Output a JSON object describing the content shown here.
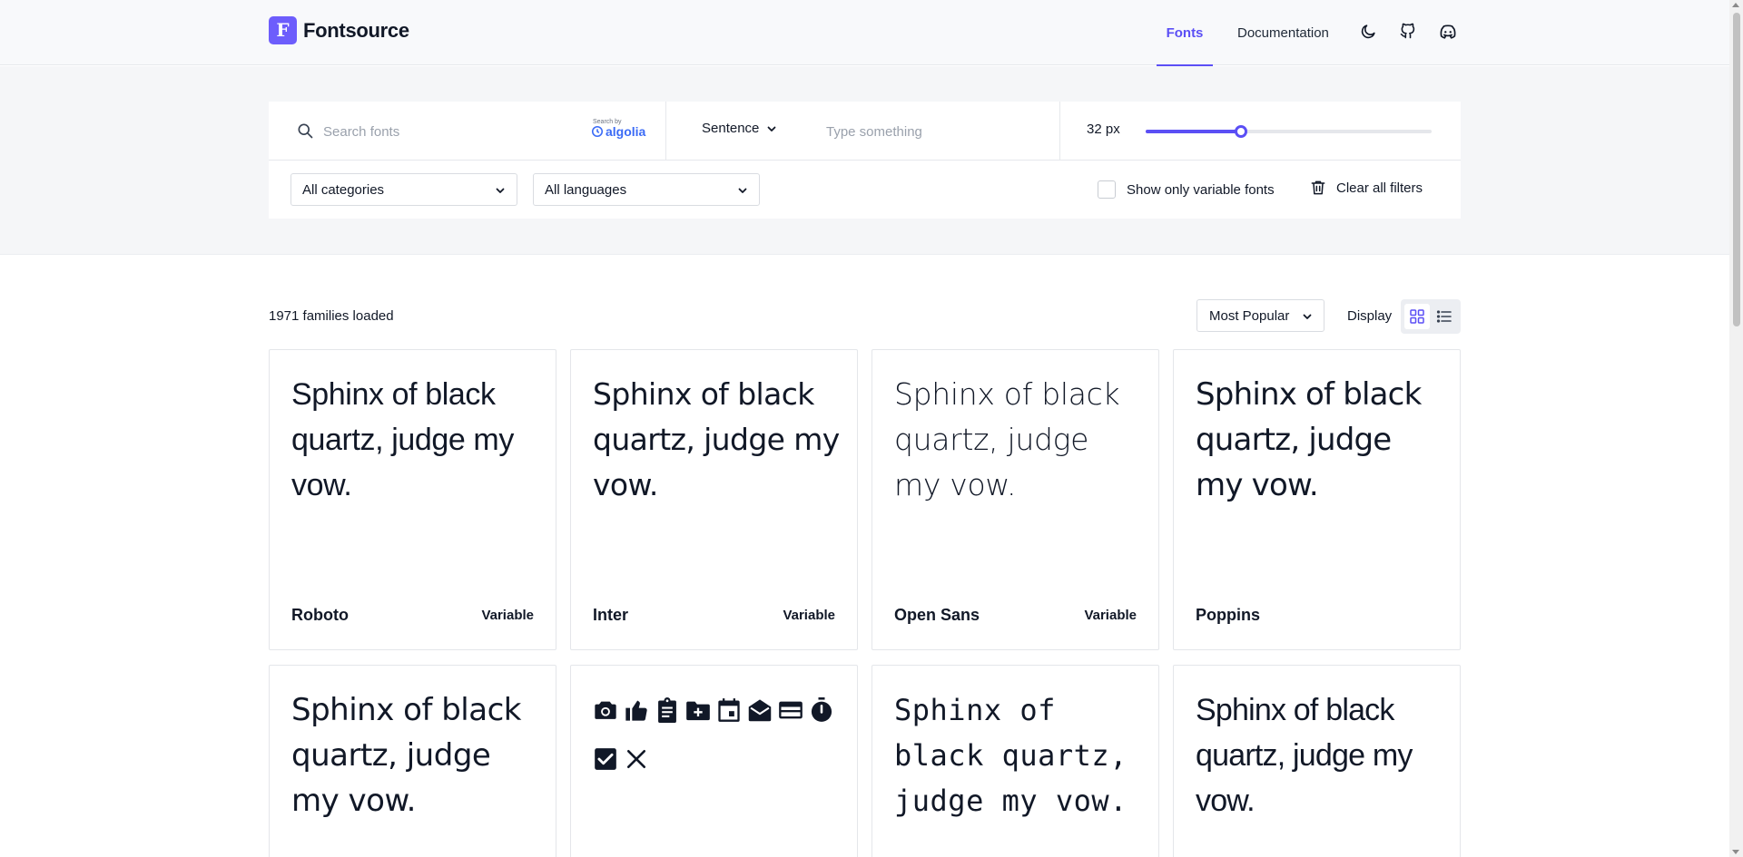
{
  "header": {
    "logo_letter": "F",
    "logo_text": "Fontsource",
    "nav": [
      {
        "label": "Fonts",
        "active": true
      },
      {
        "label": "Documentation",
        "active": false
      }
    ],
    "icons": [
      "moon-icon",
      "github-icon",
      "discord-icon"
    ]
  },
  "search": {
    "placeholder": "Search fonts",
    "value": "",
    "powered_small": "Search by",
    "powered_brand": "algolia"
  },
  "preview": {
    "mode": "Sentence",
    "placeholder": "Type something",
    "value": ""
  },
  "size": {
    "label": "32 px",
    "value": 32,
    "min": 8,
    "max": 80
  },
  "filters": {
    "category": "All categories",
    "language": "All languages",
    "variable_label": "Show only variable fonts",
    "variable_checked": false,
    "clear_label": "Clear all filters"
  },
  "results": {
    "count_text": "1971 families loaded",
    "sort": "Most Popular",
    "display_label": "Display",
    "display_mode": "grid"
  },
  "cards": [
    {
      "name": "Roboto",
      "badge": "Variable",
      "preview": "Sphinx of black quartz, judge my vow."
    },
    {
      "name": "Inter",
      "badge": "Variable",
      "preview": "Sphinx of black quartz, judge my vow."
    },
    {
      "name": "Open Sans",
      "badge": "Variable",
      "preview": "Sphinx of black quartz, judge my vow."
    },
    {
      "name": "Poppins",
      "badge": "",
      "preview": "Sphinx of black quartz, judge my vow."
    },
    {
      "name": "",
      "badge": "",
      "preview": "Sphinx of black quartz, judge my vow."
    },
    {
      "name": "",
      "badge": "",
      "preview": "",
      "icons": [
        "camera-icon",
        "thumb-up-icon",
        "clipboard-icon",
        "folder-add-icon",
        "calendar-icon",
        "open-mail-icon",
        "credit-card-icon",
        "timer-icon",
        "check-box-icon",
        "close-icon"
      ]
    },
    {
      "name": "",
      "badge": "",
      "preview": "Sphinx of black quartz, judge my vow."
    },
    {
      "name": "",
      "badge": "",
      "preview": "Sphinx of black quartz, judge my vow."
    }
  ],
  "colors": {
    "accent": "#5b4ff5",
    "logo_bg": "#6d5dfc",
    "text": "#111827",
    "band_bg": "#f5f6f8"
  }
}
